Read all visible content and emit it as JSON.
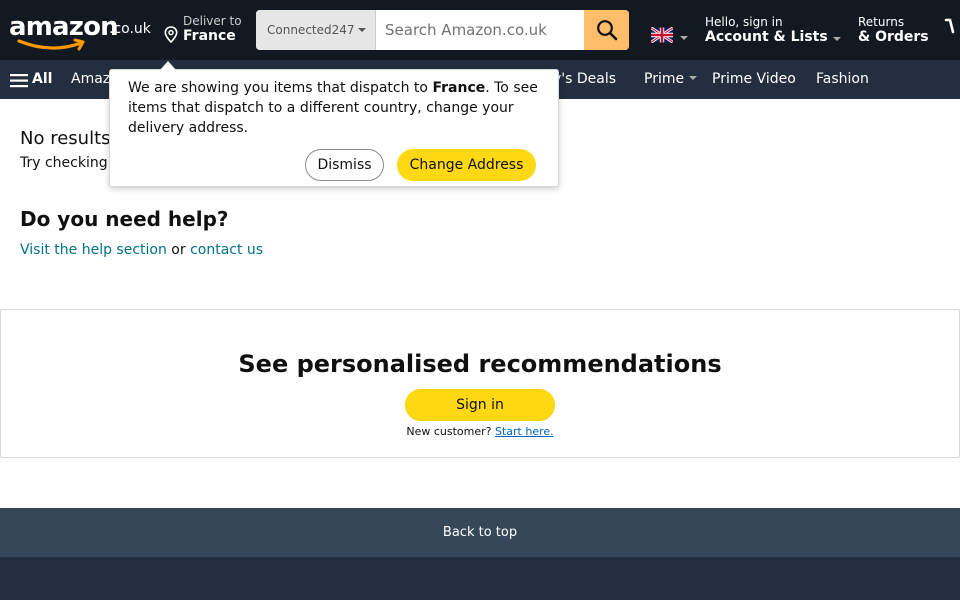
{
  "header": {
    "logo_text": "amazon",
    "logo_tld": ".co.uk",
    "deliver_label": "Deliver to",
    "deliver_country": "France",
    "search": {
      "category": "Connected247",
      "placeholder": "Search Amazon.co.uk",
      "value": ""
    },
    "language_icon": "uk-flag-icon",
    "account_greeting": "Hello, sign in",
    "account_label": "Account & Lists",
    "returns_label": "Returns",
    "orders_label": "& Orders"
  },
  "subnav": {
    "all_label": "All",
    "links": [
      "Amaz",
      "y's Deals",
      "Prime",
      "Prime Video",
      "Fashion"
    ]
  },
  "main": {
    "no_results": "No results",
    "try_checking": "Try checking",
    "help_title": "Do you need help?",
    "help_link": "Visit the help section",
    "help_or": "or",
    "contact_link": "contact us"
  },
  "popover": {
    "text_before": "We are showing you items that dispatch to ",
    "country": "France",
    "text_after": ". To see items that dispatch to a different country, change your delivery address.",
    "dismiss_label": "Dismiss",
    "change_label": "Change Address"
  },
  "recommendations": {
    "title": "See personalised recommendations",
    "signin_label": "Sign in",
    "new_customer": "New customer?",
    "start_here": "Start here."
  },
  "footer": {
    "back_to_top": "Back to top"
  },
  "colors": {
    "nav_top": "#131921",
    "nav_sub": "#232f3e",
    "search_button": "#febd69",
    "primary_button": "#ffd814",
    "link": "#007185",
    "back_to_top": "#37475a"
  }
}
